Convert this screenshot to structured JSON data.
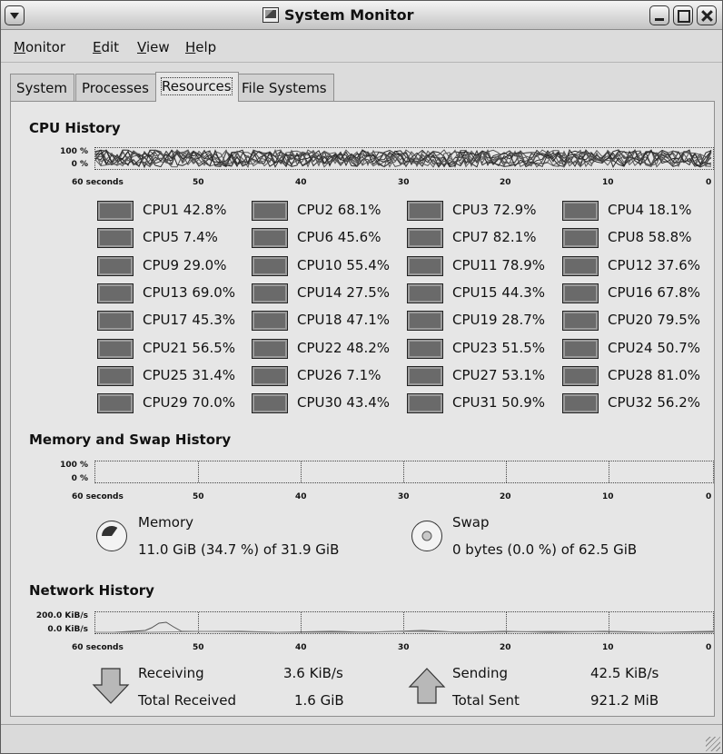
{
  "window": {
    "title": "System Monitor"
  },
  "menubar": {
    "items": [
      "Monitor",
      "Edit",
      "View",
      "Help"
    ]
  },
  "tabs": [
    "System",
    "Processes",
    "Resources",
    "File Systems"
  ],
  "active_tab": "Resources",
  "cpu_history": {
    "title": "CPU History",
    "y_top": "100 %",
    "y_bottom": "0 %",
    "x_labels": [
      "60 seconds",
      "50",
      "40",
      "30",
      "20",
      "10",
      "0"
    ],
    "cpus": [
      {
        "label": "CPU1 42.8%"
      },
      {
        "label": "CPU2 68.1%"
      },
      {
        "label": "CPU3 72.9%"
      },
      {
        "label": "CPU4 18.1%"
      },
      {
        "label": "CPU5 7.4%"
      },
      {
        "label": "CPU6 45.6%"
      },
      {
        "label": "CPU7 82.1%"
      },
      {
        "label": "CPU8 58.8%"
      },
      {
        "label": "CPU9 29.0%"
      },
      {
        "label": "CPU10 55.4%"
      },
      {
        "label": "CPU11 78.9%"
      },
      {
        "label": "CPU12 37.6%"
      },
      {
        "label": "CPU13 69.0%"
      },
      {
        "label": "CPU14 27.5%"
      },
      {
        "label": "CPU15 44.3%"
      },
      {
        "label": "CPU16 67.8%"
      },
      {
        "label": "CPU17 45.3%"
      },
      {
        "label": "CPU18 47.1%"
      },
      {
        "label": "CPU19 28.7%"
      },
      {
        "label": "CPU20 79.5%"
      },
      {
        "label": "CPU21 56.5%"
      },
      {
        "label": "CPU22 48.2%"
      },
      {
        "label": "CPU23 51.5%"
      },
      {
        "label": "CPU24 50.7%"
      },
      {
        "label": "CPU25 31.4%"
      },
      {
        "label": "CPU26 7.1%"
      },
      {
        "label": "CPU27 53.1%"
      },
      {
        "label": "CPU28 81.0%"
      },
      {
        "label": "CPU29 70.0%"
      },
      {
        "label": "CPU30 43.4%"
      },
      {
        "label": "CPU31 50.9%"
      },
      {
        "label": "CPU32 56.2%"
      }
    ]
  },
  "memory_history": {
    "title": "Memory and Swap History",
    "y_top": "100 %",
    "y_bottom": "0 %",
    "x_labels": [
      "60 seconds",
      "50",
      "40",
      "30",
      "20",
      "10",
      "0"
    ],
    "memory": {
      "label": "Memory",
      "value": "11.0 GiB (34.7 %) of 31.9 GiB",
      "fraction": 0.347
    },
    "swap": {
      "label": "Swap",
      "value": "0 bytes (0.0 %) of 62.5 GiB",
      "fraction": 0.0
    }
  },
  "network_history": {
    "title": "Network History",
    "y_top": "200.0 KiB/s",
    "y_bottom": "0.0 KiB/s",
    "x_labels": [
      "60 seconds",
      "50",
      "40",
      "30",
      "20",
      "10",
      "0"
    ],
    "receiving_label": "Receiving",
    "receiving_value": "3.6 KiB/s",
    "total_received_label": "Total Received",
    "total_received_value": "1.6 GiB",
    "sending_label": "Sending",
    "sending_value": "42.5 KiB/s",
    "total_sent_label": "Total Sent",
    "total_sent_value": "921.2 MiB"
  },
  "colors": {
    "background": "#dcdcdc",
    "swatch": "#6a6a6a",
    "graph_line": "#444444"
  }
}
